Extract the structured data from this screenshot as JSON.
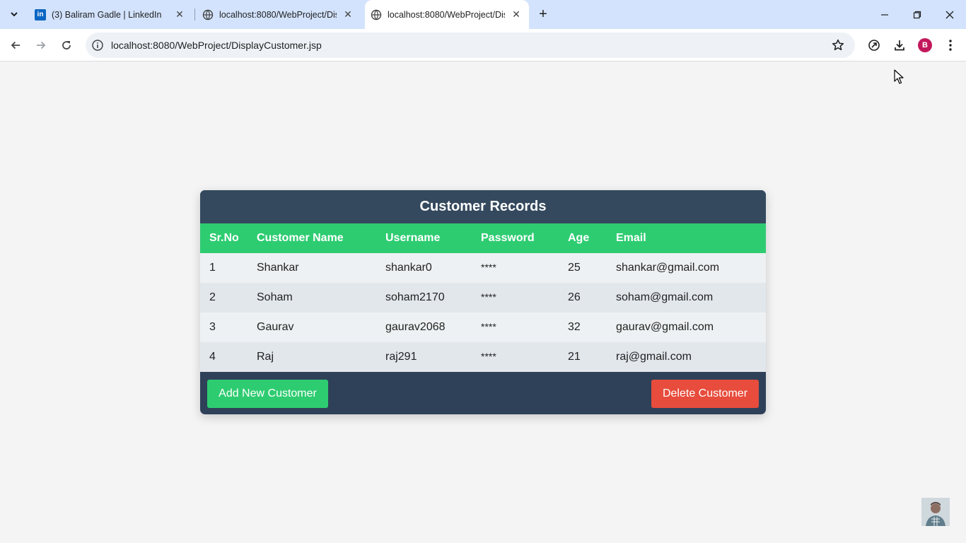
{
  "browser": {
    "tabs": [
      {
        "title": "(3) Baliram Gadle | LinkedIn",
        "favicon": "linkedin-icon",
        "active": false
      },
      {
        "title": "localhost:8080/WebProject/Disp",
        "favicon": "globe-icon",
        "active": false
      },
      {
        "title": "localhost:8080/WebProject/Disp",
        "favicon": "globe-icon",
        "active": true
      }
    ],
    "url": "localhost:8080/WebProject/DisplayCustomer.jsp",
    "profile_initial": "B",
    "linkedin_logo_text": "in"
  },
  "page": {
    "title": "Customer Records",
    "columns": [
      "Sr.No",
      "Customer Name",
      "Username",
      "Password",
      "Age",
      "Email"
    ],
    "rows": [
      {
        "sr": "1",
        "name": "Shankar",
        "username": "shankar0",
        "password": "****",
        "age": "25",
        "email": "shankar@gmail.com"
      },
      {
        "sr": "2",
        "name": "Soham",
        "username": "soham2170",
        "password": "****",
        "age": "26",
        "email": "soham@gmail.com"
      },
      {
        "sr": "3",
        "name": "Gaurav",
        "username": "gaurav2068",
        "password": "****",
        "age": "32",
        "email": "gaurav@gmail.com"
      },
      {
        "sr": "4",
        "name": "Raj",
        "username": "raj291",
        "password": "****",
        "age": "21",
        "email": "raj@gmail.com"
      }
    ],
    "add_button": "Add New Customer",
    "delete_button": "Delete Customer"
  },
  "colors": {
    "header_dark": "#34495e",
    "header_green": "#2ecc71",
    "delete_red": "#e74c3c",
    "tabstrip": "#d3e3fd"
  }
}
